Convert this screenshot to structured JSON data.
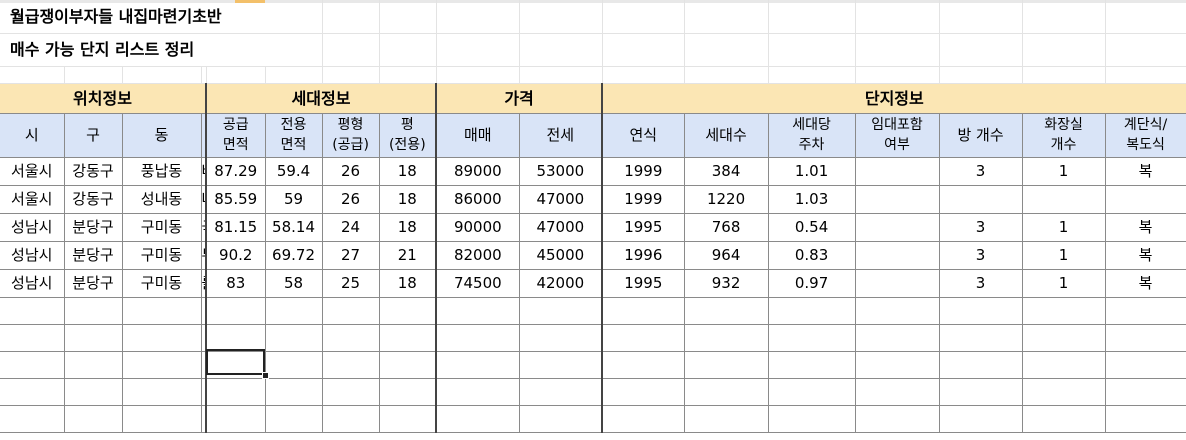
{
  "sheet": {
    "title1": "월급쟁이부자들 내집마련기초반",
    "title2": "매수 가능 단지 리스트 정리",
    "groups": {
      "location": "위치정보",
      "household": "세대정보",
      "price": "가격",
      "complex": "단지정보"
    },
    "headers": {
      "si": "시",
      "gu": "구",
      "dong": "동",
      "supply_area_1": "공급",
      "supply_area_2": "면적",
      "exclusive_area_1": "전용",
      "exclusive_area_2": "면적",
      "pyeong_supply_1": "평형",
      "pyeong_supply_2": "(공급)",
      "pyeong_excl_1": "평",
      "pyeong_excl_2": "(전용)",
      "sale": "매매",
      "jeonse": "전세",
      "year": "연식",
      "households": "세대수",
      "parking_1": "세대당",
      "parking_2": "주차",
      "rental_1": "임대포함",
      "rental_2": "여부",
      "rooms": "방 개수",
      "bath_1": "화장실",
      "bath_2": "개수",
      "stair_1": "계단식/",
      "stair_2": "복도식"
    },
    "rows": [
      {
        "si": "서울시",
        "gu": "강동구",
        "dong": "풍납동",
        "name": "바",
        "supply": "87.29",
        "excl": "59.4",
        "py_s": "26",
        "py_e": "18",
        "sale": "89000",
        "jeonse": "53000",
        "year": "1999",
        "hh": "384",
        "park": "1.01",
        "rental": "",
        "rooms": "3",
        "bath": "1",
        "stair": "복"
      },
      {
        "si": "서울시",
        "gu": "강동구",
        "dong": "성내동",
        "name": "나",
        "supply": "85.59",
        "excl": "59",
        "py_s": "26",
        "py_e": "18",
        "sale": "86000",
        "jeonse": "47000",
        "year": "1999",
        "hh": "1220",
        "park": "1.03",
        "rental": "",
        "rooms": "",
        "bath": "",
        "stair": ""
      },
      {
        "si": "성남시",
        "gu": "분당구",
        "dong": "구미동",
        "name": "국",
        "supply": "81.15",
        "excl": "58.14",
        "py_s": "24",
        "py_e": "18",
        "sale": "90000",
        "jeonse": "47000",
        "year": "1995",
        "hh": "768",
        "park": "0.54",
        "rental": "",
        "rooms": "3",
        "bath": "1",
        "stair": "복"
      },
      {
        "si": "성남시",
        "gu": "분당구",
        "dong": "구미동",
        "name": "무",
        "supply": "90.2",
        "excl": "69.72",
        "py_s": "27",
        "py_e": "21",
        "sale": "82000",
        "jeonse": "45000",
        "year": "1996",
        "hh": "964",
        "park": "0.83",
        "rental": "",
        "rooms": "3",
        "bath": "1",
        "stair": "복"
      },
      {
        "si": "성남시",
        "gu": "분당구",
        "dong": "구미동",
        "name": "를",
        "supply": "83",
        "excl": "58",
        "py_s": "25",
        "py_e": "18",
        "sale": "74500",
        "jeonse": "42000",
        "year": "1995",
        "hh": "932",
        "park": "0.97",
        "rental": "",
        "rooms": "3",
        "bath": "1",
        "stair": "복"
      }
    ],
    "colors": {
      "header_fill": "#fbe6b4",
      "subheader_fill": "#d9e4f7",
      "grid_line": "#d4d4d4",
      "accent": "#f3c06a"
    }
  }
}
